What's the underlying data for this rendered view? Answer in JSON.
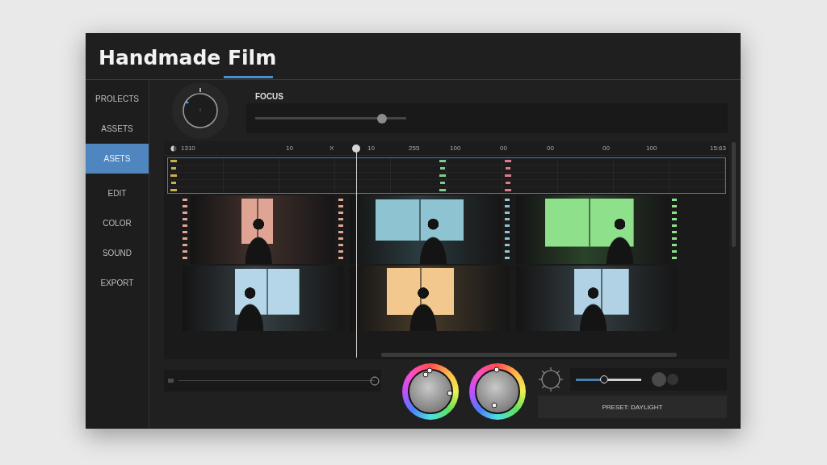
{
  "window": {
    "title": "Handmade Film"
  },
  "sidebar": {
    "items": [
      {
        "label": "PROLECTS",
        "selected": false
      },
      {
        "label": "ASSETS",
        "selected": false
      },
      {
        "label": "ASETS",
        "selected": true
      },
      {
        "label": "EDIT",
        "selected": false
      },
      {
        "label": "COLOR",
        "selected": false
      },
      {
        "label": "SOUND",
        "selected": false
      },
      {
        "label": "EXPORT",
        "selected": false
      }
    ]
  },
  "focus": {
    "label": "FOCUS",
    "level": 0.84
  },
  "timeline": {
    "ruler": [
      "1310",
      "10",
      "X",
      "10",
      "255",
      "100",
      "00",
      "00",
      "00",
      "100",
      "15:63"
    ],
    "playhead": {
      "level": 0.34
    },
    "markers": [
      {
        "color": "#c8b04a"
      },
      {
        "color": "#7ad08a"
      },
      {
        "color": "#e07a8a"
      }
    ],
    "clips": [
      {
        "perforations": {
          "left": true,
          "right": true
        },
        "color": "#e0a494"
      },
      {
        "perforations": {
          "left": false,
          "right": true
        },
        "color": "#8ec4d2"
      },
      {
        "perforations": {
          "left": false,
          "right": true
        },
        "color": "#8ee08a"
      },
      {
        "perforations": {
          "left": false,
          "right": false
        },
        "color": "#b4d6e8"
      },
      {
        "perforations": {
          "left": false,
          "right": false
        },
        "color": "#f2c88e"
      },
      {
        "perforations": {
          "left": false,
          "right": false
        },
        "color": "#b0d2e4"
      }
    ]
  },
  "bottom": {
    "scrubber": {
      "level": 1
    },
    "balance_slider": {
      "level": 0.43
    },
    "preset_button": "PRESET: DAYLIGHT"
  }
}
